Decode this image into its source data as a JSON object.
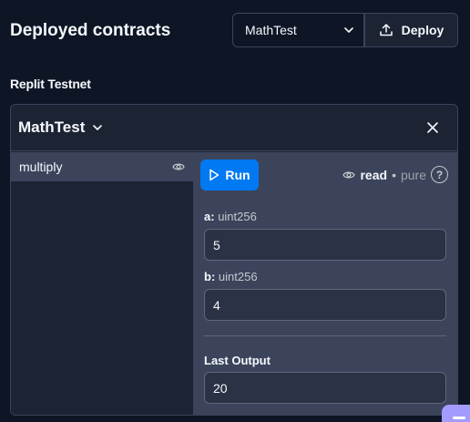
{
  "header": {
    "title": "Deployed contracts",
    "contract_select_value": "MathTest",
    "deploy_label": "Deploy"
  },
  "network": "Replit Testnet",
  "contract": {
    "name": "MathTest",
    "functions": [
      {
        "label": "multiply",
        "selected": true
      }
    ]
  },
  "function_form": {
    "run_label": "Run",
    "mutability": {
      "read": "read",
      "separator": "•",
      "pure": "pure",
      "help": "?"
    },
    "params": [
      {
        "name": "a:",
        "type": "uint256",
        "value": "5"
      },
      {
        "name": "b:",
        "type": "uint256",
        "value": "4"
      }
    ],
    "output_label": "Last Output",
    "output_value": "20"
  },
  "colors": {
    "background": "#0e1525",
    "panel": "#1c2333",
    "surface": "#3c445c",
    "accent": "#0079f2"
  }
}
